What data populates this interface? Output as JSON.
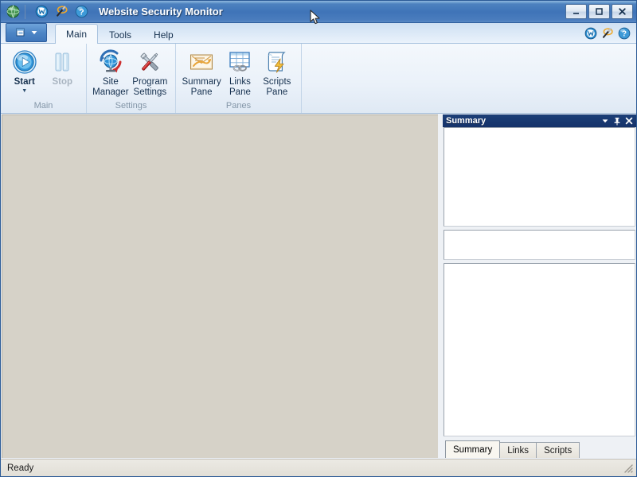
{
  "window": {
    "title": "Website Security Monitor",
    "icon": "globe-icon",
    "minimize_label": "Minimize",
    "maximize_label": "Maximize",
    "close_label": "Close"
  },
  "quick_access": [
    {
      "name": "site-globe-icon",
      "label": "Sites"
    },
    {
      "name": "wand-icon",
      "label": "Tools"
    },
    {
      "name": "help-icon",
      "label": "Help"
    }
  ],
  "ribbon": {
    "app_menu_label": "Application Menu",
    "tabs": [
      {
        "label": "Main",
        "active": true
      },
      {
        "label": "Tools",
        "active": false
      },
      {
        "label": "Help",
        "active": false
      }
    ],
    "corner_icons": [
      {
        "name": "site-globe-icon",
        "label": "Sites"
      },
      {
        "name": "wand-icon",
        "label": "Tools"
      },
      {
        "name": "help-icon",
        "label": "Help"
      }
    ],
    "groups": [
      {
        "label": "Main",
        "buttons": [
          {
            "label": "Start",
            "icon": "play-icon",
            "bold": true,
            "disabled": false,
            "has_caret": true
          },
          {
            "label": "Stop",
            "icon": "pause-icon",
            "bold": true,
            "disabled": true,
            "has_caret": false
          }
        ]
      },
      {
        "label": "Settings",
        "buttons": [
          {
            "label": "Site\nManager",
            "icon": "site-manager-icon",
            "bold": false,
            "disabled": false,
            "has_caret": false
          },
          {
            "label": "Program\nSettings",
            "icon": "program-settings-icon",
            "bold": false,
            "disabled": false,
            "has_caret": false
          }
        ]
      },
      {
        "label": "Panes",
        "buttons": [
          {
            "label": "Summary\nPane",
            "icon": "summary-pane-icon",
            "bold": false,
            "disabled": false,
            "has_caret": false
          },
          {
            "label": "Links\nPane",
            "icon": "links-pane-icon",
            "bold": false,
            "disabled": false,
            "has_caret": false
          },
          {
            "label": "Scripts\nPane",
            "icon": "scripts-pane-icon",
            "bold": false,
            "disabled": false,
            "has_caret": false
          }
        ]
      }
    ]
  },
  "dock_panel": {
    "title": "Summary",
    "buttons": [
      {
        "name": "pane-menu-icon",
        "glyph": "▾"
      },
      {
        "name": "pin-icon",
        "glyph": "⚐"
      },
      {
        "name": "close-icon",
        "glyph": "✕"
      }
    ],
    "panes": [
      {
        "name": "summary-list-pane",
        "content": ""
      },
      {
        "name": "summary-detail-pane",
        "content": ""
      },
      {
        "name": "summary-log-pane",
        "content": ""
      }
    ],
    "tabs": [
      {
        "label": "Summary",
        "active": true
      },
      {
        "label": "Links",
        "active": false
      },
      {
        "label": "Scripts",
        "active": false
      }
    ]
  },
  "main_area": {
    "content": "",
    "background_color": "#d6d2c8"
  },
  "status_bar": {
    "text": "Ready"
  },
  "colors": {
    "title_bar": "#4a7cbd",
    "panel_header": "#1c3f77",
    "ribbon": "#eaf1f9",
    "workspace": "#d6d2c8",
    "accent": "#2f5f9e"
  }
}
